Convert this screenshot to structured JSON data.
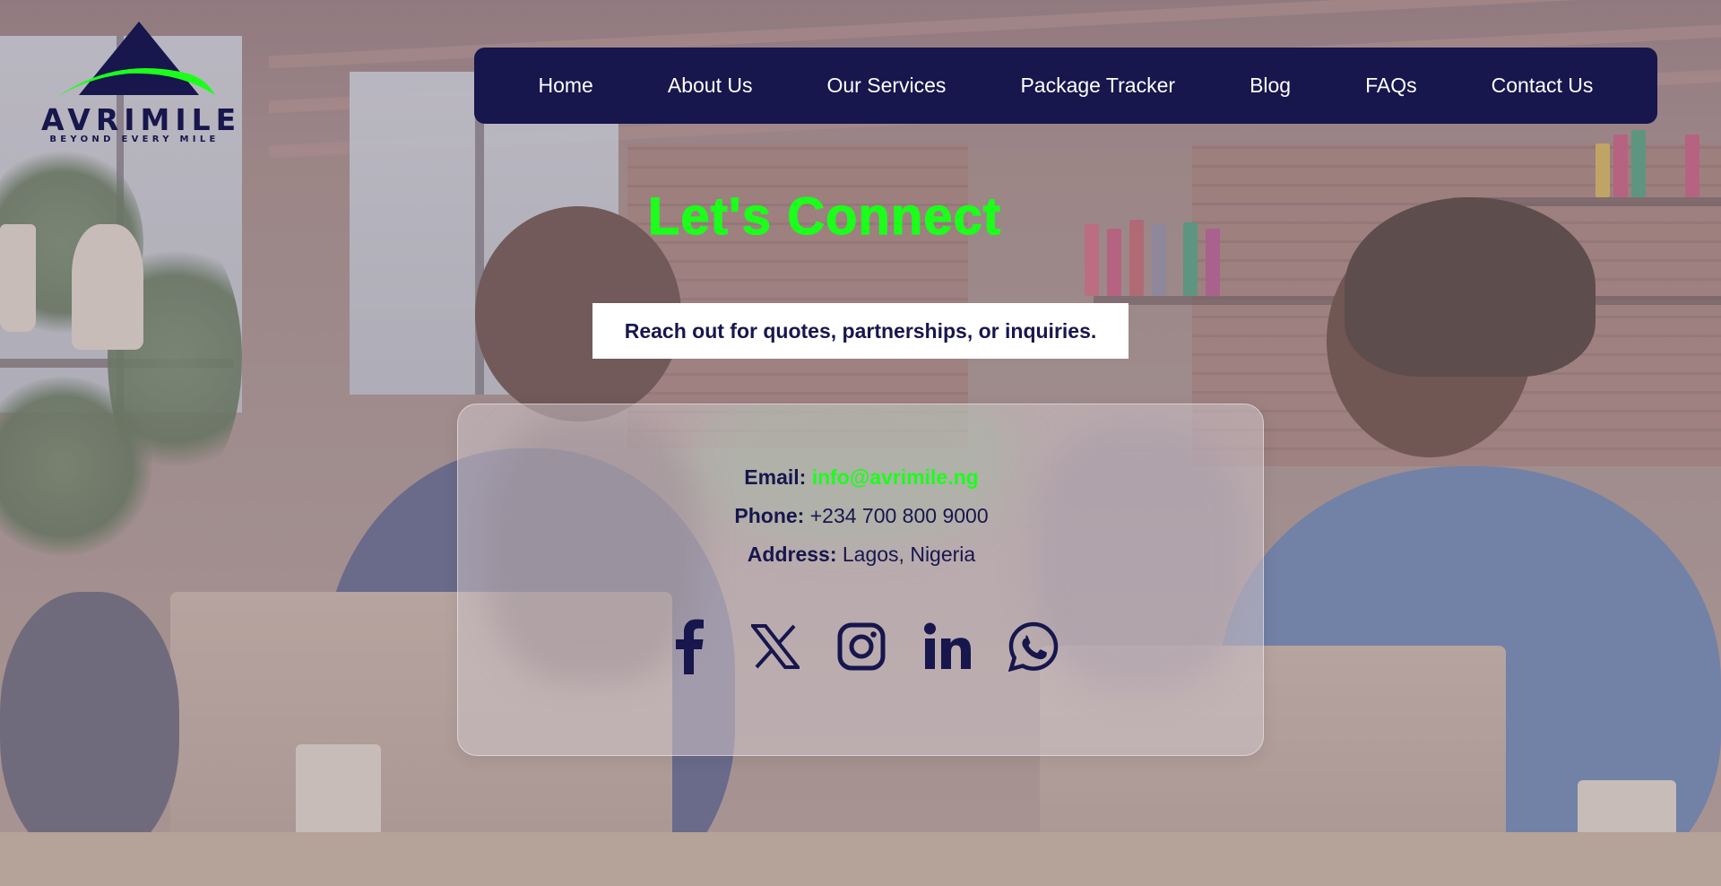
{
  "brand": {
    "name": "AVRIMILE",
    "tagline": "BEYOND EVERY MILE",
    "colors": {
      "navy": "#17164d",
      "green": "#1bff1b"
    }
  },
  "nav": {
    "items": [
      {
        "label": "Home"
      },
      {
        "label": "About Us"
      },
      {
        "label": "Our Services"
      },
      {
        "label": "Package Tracker"
      },
      {
        "label": "Blog"
      },
      {
        "label": "FAQs"
      },
      {
        "label": "Contact Us"
      }
    ]
  },
  "hero": {
    "title": "Let's Connect",
    "subtitle": "Reach out for quotes, partnerships, or inquiries."
  },
  "contact": {
    "email_label": "Email:",
    "email_value": "info@avrimile.ng",
    "phone_label": "Phone:",
    "phone_value": "+234 700 800 9000",
    "address_label": "Address:",
    "address_value": "Lagos, Nigeria"
  },
  "socials": [
    {
      "icon": "facebook-icon"
    },
    {
      "icon": "x-twitter-icon"
    },
    {
      "icon": "instagram-icon"
    },
    {
      "icon": "linkedin-icon"
    },
    {
      "icon": "whatsapp-icon"
    }
  ]
}
